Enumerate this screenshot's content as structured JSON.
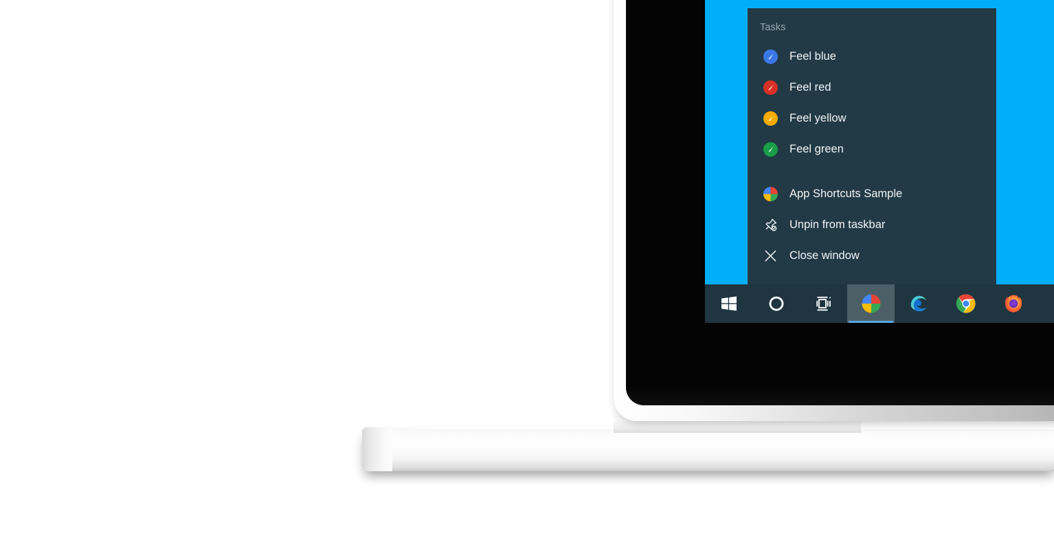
{
  "scene": {
    "device": "laptop",
    "os": "Windows 10",
    "desktop_color": "#00aefa",
    "taskbar_color": "#1f3540",
    "jumplist_color": "#223a45",
    "accent_underline_color": "#5aa9e6",
    "active_highlight_color": "#4d5f66"
  },
  "jumplist": {
    "header": "Tasks",
    "tasks": [
      {
        "label": "Feel blue",
        "icon": "blue-brush-circle-icon",
        "color": "#3b78e7"
      },
      {
        "label": "Feel red",
        "icon": "red-brush-circle-icon",
        "color": "#d93025"
      },
      {
        "label": "Feel yellow",
        "icon": "yellow-brush-circle-icon",
        "color": "#f9ab00"
      },
      {
        "label": "Feel green",
        "icon": "green-brush-circle-icon",
        "color": "#189e48"
      }
    ],
    "system_items": [
      {
        "label": "App Shortcuts Sample",
        "icon": "app-shortcuts-sample-icon"
      },
      {
        "label": "Unpin from taskbar",
        "icon": "unpin-icon"
      },
      {
        "label": "Close window",
        "icon": "close-icon"
      }
    ]
  },
  "taskbar": {
    "buttons": [
      {
        "name": "start",
        "label": "Start",
        "icon": "windows-logo-icon",
        "active": false
      },
      {
        "name": "cortana",
        "label": "Cortana",
        "icon": "cortana-circle-icon",
        "active": false
      },
      {
        "name": "task-view",
        "label": "Task View",
        "icon": "task-view-icon",
        "active": false
      },
      {
        "name": "app-shortcuts-sample",
        "label": "App Shortcuts Sample",
        "icon": "app-shortcuts-sample-icon",
        "active": true
      },
      {
        "name": "microsoft-edge",
        "label": "Microsoft Edge",
        "icon": "edge-icon",
        "active": false
      },
      {
        "name": "google-chrome",
        "label": "Google Chrome",
        "icon": "chrome-icon",
        "active": false
      },
      {
        "name": "mozilla-firefox",
        "label": "Mozilla Firefox",
        "icon": "firefox-icon",
        "active": false
      }
    ]
  }
}
